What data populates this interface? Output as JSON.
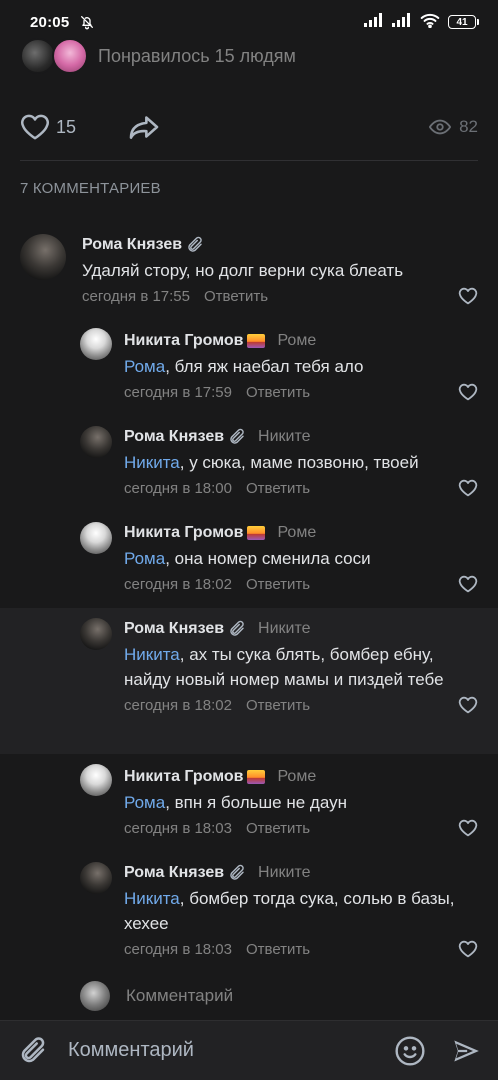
{
  "status_bar": {
    "time": "20:05",
    "battery": "41"
  },
  "likes_summary": {
    "text": "Понравилось 15 людям"
  },
  "post_actions": {
    "like_count": "15",
    "views": "82"
  },
  "comments_header": "7 КОММЕНТАРИЕВ",
  "comments": [
    {
      "author": "Рома Князев",
      "emoji": "paperclip",
      "reply_to": "",
      "mention": "",
      "text": "Удаляй стору, но долг верни сука блеать",
      "time": "сегодня в 17:55",
      "reply_label": "Ответить"
    },
    {
      "author": "Никита Громов",
      "emoji": "sunset",
      "reply_to": "Роме",
      "mention": "Рома",
      "text": ", бля яж наебал тебя ало",
      "time": "сегодня в 17:59",
      "reply_label": "Ответить"
    },
    {
      "author": "Рома Князев",
      "emoji": "paperclip",
      "reply_to": "Никите",
      "mention": "Никита",
      "text": ", у сюка, маме позвоню, твоей",
      "time": "сегодня в 18:00",
      "reply_label": "Ответить"
    },
    {
      "author": "Никита Громов",
      "emoji": "sunset",
      "reply_to": "Роме",
      "mention": "Рома",
      "text": ", она номер сменила соси",
      "time": "сегодня в 18:02",
      "reply_label": "Ответить"
    },
    {
      "author": "Рома Князев",
      "emoji": "paperclip",
      "reply_to": "Никите",
      "mention": "Никита",
      "text": ", ах ты сука блять, бомбер ебну, найду новый номер мамы и пиздей тебе",
      "time": "сегодня в 18:02",
      "reply_label": "Ответить"
    },
    {
      "author": "Никита Громов",
      "emoji": "sunset",
      "reply_to": "Роме",
      "mention": "Рома",
      "text": ", впн я больше не даун",
      "time": "сегодня в 18:03",
      "reply_label": "Ответить"
    },
    {
      "author": "Рома Князев",
      "emoji": "paperclip",
      "reply_to": "Никите",
      "mention": "Никита",
      "text": ", бомбер тогда сука, солью в базы, хехее",
      "time": "сегодня в 18:03",
      "reply_label": "Ответить"
    }
  ],
  "reply_input": {
    "placeholder": "Комментарий"
  },
  "composer": {
    "placeholder": "Комментарий"
  },
  "colors": {
    "background": "#19191a",
    "mention": "#71aaeb",
    "secondary_text": "#828282"
  }
}
